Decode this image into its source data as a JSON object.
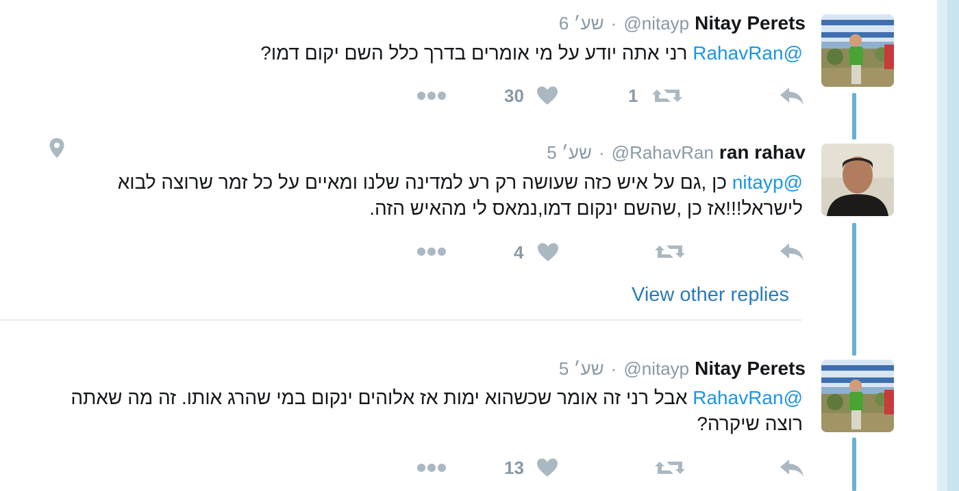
{
  "tweets": [
    {
      "name": "Nitay Perets",
      "handle": "@nitayp",
      "time": "6 שע׳",
      "mention": "@RahavRan",
      "line1": "רני אתה יודע על מי אומרים בדרך כלל השם יקום דמו?",
      "line2": "",
      "likes": "30",
      "retweets": "1"
    },
    {
      "name": "ran rahav",
      "handle": "@RahavRan",
      "time": "5 שע׳",
      "mention": "@nitayp",
      "line1": "כן ,גם על איש כזה שעושה רק רע למדינה שלנו ומאיים על כל זמר שרוצה לבוא",
      "line2": "לישראל!!!אז כן ,שהשם ינקום דמו,נמאס לי מהאיש הזה.",
      "likes": "4",
      "retweets": ""
    },
    {
      "name": "Nitay Perets",
      "handle": "@nitayp",
      "time": "5 שע׳",
      "mention": "@RahavRan",
      "line1": "אבל רני זה אומר שכשהוא ימות אז אלוהים ינקום במי שהרג אותו. זה מה שאתה",
      "line2": "רוצה שיקרה?",
      "likes": "13",
      "retweets": ""
    }
  ],
  "view_other_replies": "View other replies",
  "separator": "·",
  "icons": {
    "reply": "reply-icon",
    "retweet": "retweet-icon",
    "like": "heart-icon",
    "more": "more-dots-icon",
    "location": "location-pin-icon"
  },
  "colors": {
    "link": "#1b95e0",
    "muted": "#8899a6",
    "action_icon": "#aab8c2",
    "thread_line": "#6ab0cf"
  }
}
